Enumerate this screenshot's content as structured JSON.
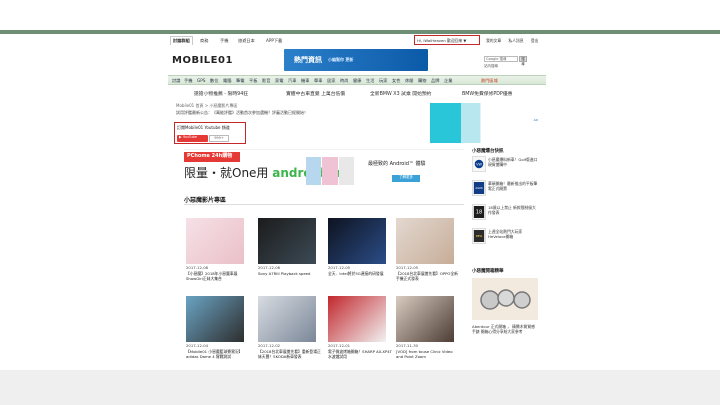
{
  "nav": {
    "items": [
      "討論群組",
      "商務",
      "手機",
      "旅遊日本",
      "APP下載"
    ],
    "user_menu": "Hi, iWaiHeaven 歡迎回來 ▼",
    "right_links": [
      "我的文章",
      "私人訊息",
      "登出"
    ]
  },
  "header": {
    "logo": "MOBILE01",
    "banner_main": "熱門資訊",
    "banner_sub": "小編幫你 更新",
    "search_placeholder": "Google 搜尋",
    "search_button": "搜尋",
    "small_link": "站內搜尋"
  },
  "categories": {
    "items": [
      "討論",
      "手機",
      "GPS",
      "數位",
      "電腦",
      "筆電",
      "平板",
      "影音",
      "家電",
      "汽車",
      "機車",
      "單車",
      "居家",
      "時尚",
      "健康",
      "生活",
      "玩家",
      "女性",
      "休閒",
      "購物",
      "品牌",
      "企業",
      "熱門區域"
    ]
  },
  "news": {
    "items": [
      "搶搶小物推薦 - 限時94狂",
      "實體中古車直覺 上萬台低價",
      "全新BMW X3 試乘 開始預約",
      "BMW免費保修PDP優惠"
    ]
  },
  "breadcrumb": "Mobile01 首頁 > 小惡魔影片專區",
  "notice": "試用評鑑最新公告：《萬能評鑑》活動首次參加選機？評審活動已經開始！",
  "youtube": {
    "title": "訂閱Mobile01 Youtube 頻道",
    "button": "YouTube",
    "count": "999+"
  },
  "main_ad": {
    "brand": "PChome 24h購物",
    "slogan_prefix": "限量・就One用",
    "slogan_android": "androidone",
    "right_text": "最極致的 Android™ 體驗",
    "button": "了解更多"
  },
  "section": {
    "title": "小惡魔影片專區"
  },
  "videos": [
    {
      "date": "2017-12-08",
      "title": "【小惡魔】2018年小惡魔車展 ShowGirl正妹大集合",
      "colors": [
        "#f6e0e7",
        "#eac0c7"
      ]
    },
    {
      "date": "2017-12-06",
      "title": "Sony A7RIII Playback speed",
      "colors": [
        "#1c1c1c",
        "#3c4a55"
      ]
    },
    {
      "date": "2017-12-05",
      "title": "全天．Intel將於5G連接的研發展",
      "colors": [
        "#0e1320",
        "#2b4d88"
      ]
    },
    {
      "date": "2017-12-05",
      "title": "【2018台北車展搶先看】OPPO全新手機正式發表",
      "colors": [
        "#e3d8d0",
        "#c7ad98"
      ]
    },
    {
      "date": "2017-12-04",
      "title": "【Mobile01 小惡魔籃球賽實況】adidas Dame 4 實戰測試",
      "colors": [
        "#6aa4c4",
        "#2e2e2e"
      ]
    },
    {
      "date": "2017-12-02",
      "title": "【2018台北車展搶先看】重新登場正妹天團！SKODA新車發表",
      "colors": [
        "#d8dce2",
        "#7b8798"
      ]
    },
    {
      "date": "2017-12-01",
      "title": "電子微波烤箱開箱！SHARP AX-XP4T水波爐試用",
      "colors": [
        "#c1272d",
        "#f2f2f2"
      ]
    },
    {
      "date": "2017-11-30",
      "title": "[VOD] from touse Clinic Video and Point Zoom",
      "colors": [
        "#d8cbbf",
        "#4d3d35"
      ]
    }
  ],
  "sidebar": {
    "section1_title": "小惡魔爆台快訊",
    "items": [
      {
        "text": "小惡魔爆料新車！Golf版進口現貨搶購中",
        "logo": "VW"
      },
      {
        "text": "華碩開箱！最新推出的平板筆電正式開賣",
        "logo": "ASUS"
      },
      {
        "text": "18歲以上禁止 新款限制級大作發表",
        "logo": "18"
      },
      {
        "text": "上週全站熱門大玩家HeVeloce開箱",
        "logo": "NEW"
      }
    ],
    "section2_title": "小惡魔開箱精華",
    "feature_text": "Aberdour 正式開箱 ， 精緻木質質感手錶 開箱心得分享給大家參考"
  }
}
